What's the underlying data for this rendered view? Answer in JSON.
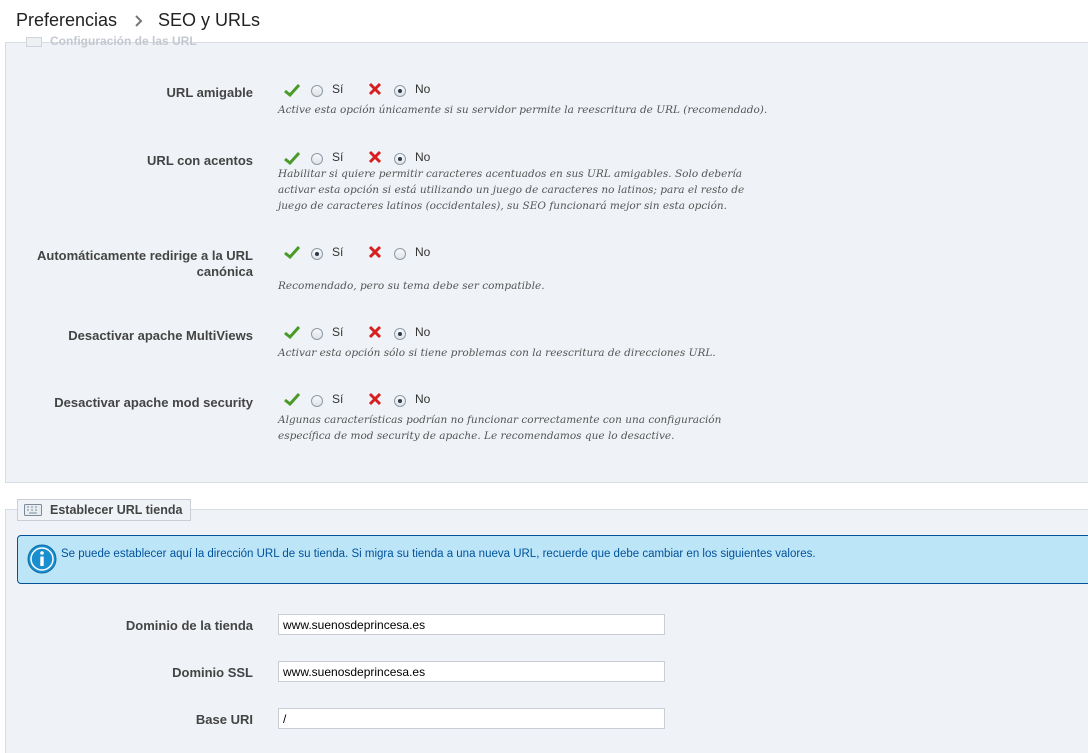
{
  "breadcrumb": {
    "parent": "Preferencias",
    "current": "SEO y URLs"
  },
  "url_section": {
    "legend": "Configuración de las URL",
    "fields": [
      {
        "label": "URL amigable",
        "yes": "Sí",
        "no": "No",
        "selected": "no",
        "help": "Active esta opción únicamente si su servidor permite la reescritura de URL (recomendado)."
      },
      {
        "label": "URL con acentos",
        "yes": "Sí",
        "no": "No",
        "selected": "no",
        "help": "Habilitar si quiere permitir caracteres acentuados en sus URL amigables. Solo debería activar esta opción si está utilizando un juego de caracteres no latinos; para el resto de juego de caracteres latinos (occidentales), su SEO funcionará mejor sin esta opción."
      },
      {
        "label_line1": "Automáticamente redirige a la URL",
        "label_line2": "canónica",
        "yes": "Sí",
        "no": "No",
        "selected": "yes",
        "help": "Recomendado, pero su tema debe ser compatible."
      },
      {
        "label": "Desactivar apache MultiViews",
        "yes": "Sí",
        "no": "No",
        "selected": "no",
        "help": "Activar esta opción sólo si tiene problemas con la reescritura de direcciones URL."
      },
      {
        "label": "Desactivar apache mod security",
        "yes": "Sí",
        "no": "No",
        "selected": "no",
        "help": "Algunas características podrían no funcionar correctamente con una configuración específica de mod security de apache. Le recomendamos que lo desactive."
      }
    ]
  },
  "shop_url_section": {
    "legend": "Establecer URL tienda",
    "info": "Se puede establecer aquí la dirección URL de su tienda. Si migra su tienda a una nueva URL, recuerde que debe cambiar en los siguientes valores.",
    "fields": [
      {
        "label": "Dominio de la tienda",
        "value": "www.suenosdeprincesa.es"
      },
      {
        "label": "Dominio SSL",
        "value": "www.suenosdeprincesa.es"
      },
      {
        "label": "Base URI",
        "value": "/"
      }
    ]
  },
  "colors": {
    "check": "#4a9a2a",
    "cross": "#d62020",
    "info_bg": "#bde5f8",
    "info_text": "#00529b",
    "panel_bg": "#eff2f6"
  },
  "icons": {
    "check": "check-icon",
    "cross": "x-icon",
    "info": "info-icon",
    "separator": "chevron-right-icon",
    "legend": "keyboard-icon"
  }
}
